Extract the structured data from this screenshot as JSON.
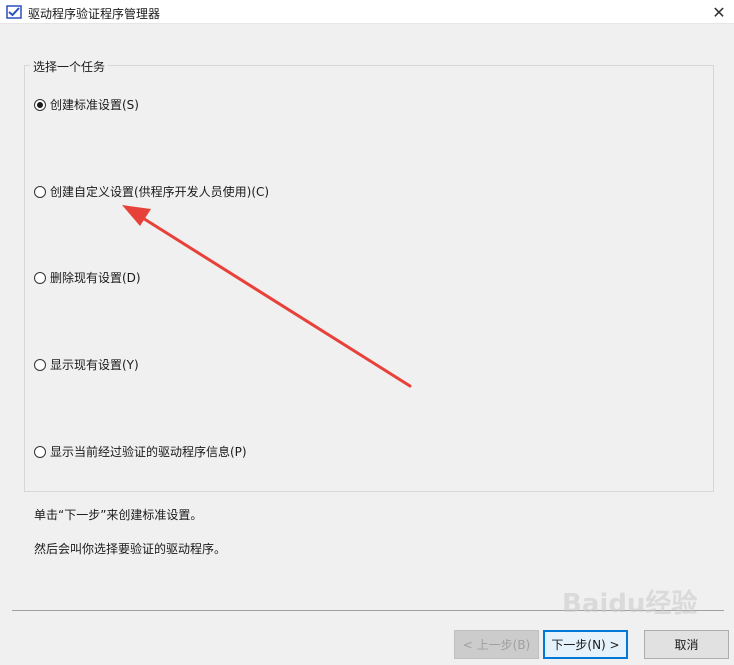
{
  "window": {
    "title": "驱动程序验证程序管理器",
    "close_glyph": "✕"
  },
  "group": {
    "legend": "选择一个任务"
  },
  "options": [
    {
      "label": "创建标准设置(S)",
      "checked": true
    },
    {
      "label": "创建自定义设置(供程序开发人员使用)(C)",
      "checked": false
    },
    {
      "label": "删除现有设置(D)",
      "checked": false
    },
    {
      "label": "显示现有设置(Y)",
      "checked": false
    },
    {
      "label": "显示当前经过验证的驱动程序信息(P)",
      "checked": false
    }
  ],
  "description": {
    "line1": "单击“下一步”来创建标准设置。",
    "line2": "然后会叫你选择要验证的驱动程序。"
  },
  "buttons": {
    "back": "< 上一步(B)",
    "next": "下一步(N) >",
    "cancel": "取消"
  },
  "annotation": {
    "arrow_color": "#e8413a"
  },
  "watermark": "Baidu经验",
  "icons": {
    "app": "verifier-checkmark-icon",
    "close": "close-icon"
  }
}
